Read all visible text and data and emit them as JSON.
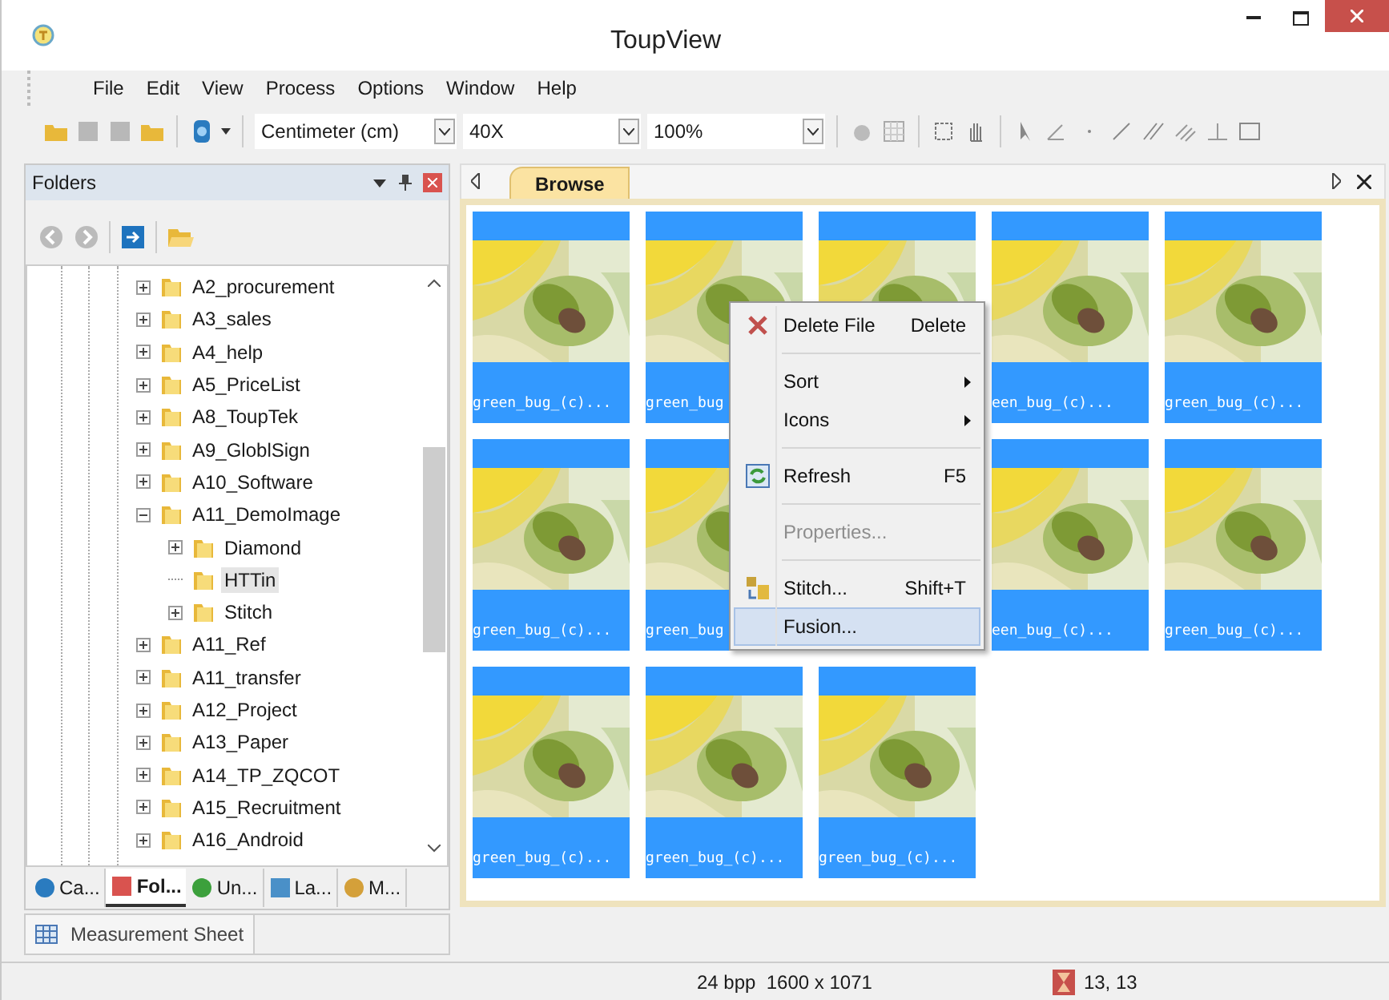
{
  "window": {
    "title": "ToupView"
  },
  "menu": [
    "File",
    "Edit",
    "View",
    "Process",
    "Options",
    "Window",
    "Help"
  ],
  "toolbar": {
    "combos": [
      {
        "value": "Centimeter (cm)"
      },
      {
        "value": "40X"
      },
      {
        "value": "100%"
      }
    ]
  },
  "folders_panel": {
    "title": "Folders",
    "tree": [
      {
        "label": "A2_procurement",
        "expanded": false,
        "selected": false
      },
      {
        "label": "A3_sales",
        "expanded": false,
        "selected": false
      },
      {
        "label": "A4_help",
        "expanded": false,
        "selected": false
      },
      {
        "label": "A5_PriceList",
        "expanded": false,
        "selected": false
      },
      {
        "label": "A8_ToupTek",
        "expanded": false,
        "selected": false
      },
      {
        "label": "A9_GloblSign",
        "expanded": false,
        "selected": false
      },
      {
        "label": "A10_Software",
        "expanded": false,
        "selected": false
      },
      {
        "label": "A11_DemoImage",
        "expanded": true,
        "selected": false,
        "children": [
          {
            "label": "Diamond",
            "expanded": false,
            "selected": false
          },
          {
            "label": "HTTin",
            "selected": true
          },
          {
            "label": "Stitch",
            "expanded": false,
            "selected": false
          }
        ]
      },
      {
        "label": "A11_Ref",
        "expanded": false,
        "selected": false
      },
      {
        "label": "A11_transfer",
        "expanded": false,
        "selected": false
      },
      {
        "label": "A12_Project",
        "expanded": false,
        "selected": false
      },
      {
        "label": "A13_Paper",
        "expanded": false,
        "selected": false
      },
      {
        "label": "A14_TP_ZQCOT",
        "expanded": false,
        "selected": false
      },
      {
        "label": "A15_Recruitment",
        "expanded": false,
        "selected": false
      },
      {
        "label": "A16_Android",
        "expanded": false,
        "selected": false
      }
    ],
    "tabs": [
      {
        "label": "Ca...",
        "selected": false
      },
      {
        "label": "Fol...",
        "selected": true
      },
      {
        "label": "Un...",
        "selected": false
      },
      {
        "label": "La...",
        "selected": false
      },
      {
        "label": "M...",
        "selected": false
      }
    ]
  },
  "bottom_tab": {
    "label": "Measurement Sheet"
  },
  "browse": {
    "tab": "Browse",
    "thumbnails": [
      {
        "kind": "picture",
        "label": "green_bug_(c)..."
      },
      {
        "kind": "picture",
        "label": "green_bug"
      },
      {
        "kind": "picture"
      },
      {
        "kind": "picture",
        "label": "een_bug_(c)..."
      },
      {
        "kind": "picture",
        "label": "green_bug_(c)..."
      },
      {
        "kind": "picture",
        "label": "green_bug_(c)..."
      },
      {
        "kind": "picture",
        "label": "green_bug"
      },
      {
        "kind": "picture",
        "label": "een_bug_(c)..."
      },
      {
        "kind": "picture",
        "label": "green_bug_(c)..."
      },
      {
        "kind": "picture",
        "label": "green_bug_(c)..."
      },
      {
        "kind": "picture",
        "label": "green_bug_(c)..."
      },
      {
        "kind": "picture",
        "label": "green_bug_(c)..."
      }
    ]
  },
  "context_menu": {
    "groups": [
      [
        {
          "label": "Delete File",
          "shortcut": "Delete",
          "kind": "delete",
          "disabled": false,
          "selected": false
        }
      ],
      [
        {
          "label": "Sort",
          "submenu": true,
          "kind": "plain",
          "disabled": false,
          "selected": false
        },
        {
          "label": "Icons",
          "submenu": true,
          "kind": "plain",
          "disabled": false,
          "selected": false
        }
      ],
      [
        {
          "label": "Refresh",
          "shortcut": "F5",
          "kind": "refresh",
          "disabled": false,
          "selected": false
        }
      ],
      [
        {
          "label": "Properties...",
          "kind": "plain",
          "disabled": true,
          "selected": false
        }
      ],
      [
        {
          "label": "Stitch...",
          "shortcut": "Shift+T",
          "kind": "stitch",
          "disabled": false,
          "selected": false
        },
        {
          "label": "Fusion...",
          "kind": "plain",
          "disabled": false,
          "selected": true
        }
      ]
    ]
  },
  "status_bar": {
    "image_info": "24 bpp  1600 x 1071",
    "position": "13, 13"
  }
}
